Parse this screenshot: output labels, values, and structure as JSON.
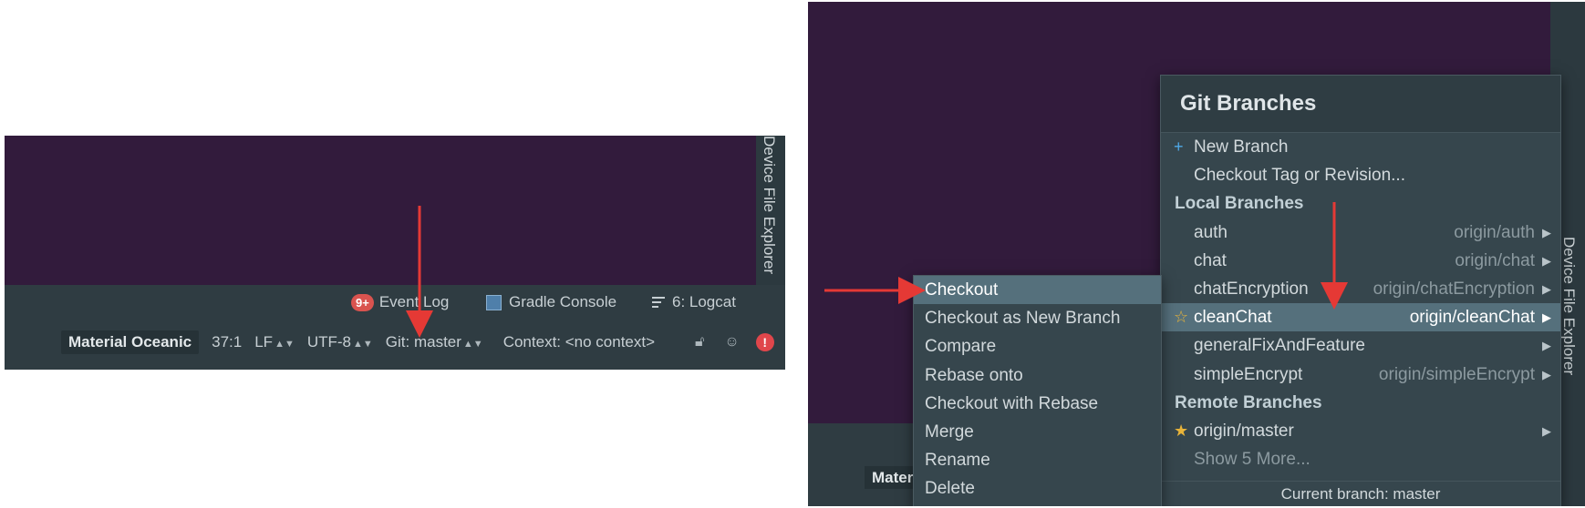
{
  "left": {
    "side_tool": "Device File Explorer",
    "tool_windows": [
      {
        "badge": "9+",
        "label": "Event Log"
      },
      {
        "label": "Gradle Console"
      },
      {
        "label": "6: Logcat"
      }
    ],
    "status": {
      "theme": "Material Oceanic",
      "position": "37:1",
      "line_sep": "LF",
      "encoding": "UTF-8",
      "git": "Git: master",
      "context": "Context: <no context>"
    }
  },
  "right": {
    "side_tool": "Device File Explorer",
    "status_theme_partial": "Mater",
    "git_branches": {
      "title": "Git Branches",
      "actions": [
        {
          "icon": "plus-icon",
          "label": "New Branch"
        },
        {
          "label": "Checkout Tag or Revision..."
        }
      ],
      "local_header": "Local Branches",
      "local": [
        {
          "name": "auth",
          "tracking": "origin/auth"
        },
        {
          "name": "chat",
          "tracking": "origin/chat"
        },
        {
          "name": "chatEncryption",
          "tracking": "origin/chatEncryption"
        },
        {
          "name": "cleanChat",
          "tracking": "origin/cleanChat",
          "selected": true,
          "icon": "star-outline-icon"
        },
        {
          "name": "generalFixAndFeature",
          "tracking": ""
        },
        {
          "name": "simpleEncrypt",
          "tracking": "origin/simpleEncrypt"
        }
      ],
      "remote_header": "Remote Branches",
      "remote": [
        {
          "name": "origin/master",
          "icon": "star-icon"
        }
      ],
      "show_more": "Show 5 More...",
      "current": "Current branch: master"
    },
    "submenu": [
      "Checkout",
      "Checkout as New Branch",
      "Compare",
      "Rebase onto",
      "Checkout with Rebase",
      "Merge",
      "Rename",
      "Delete"
    ]
  },
  "colors": {
    "editor_bg": "#321b3c",
    "panel_bg": "#2f3c42",
    "popup_bg": "#36464d",
    "selection": "#55707c",
    "annotation_arrow": "#e53935"
  }
}
